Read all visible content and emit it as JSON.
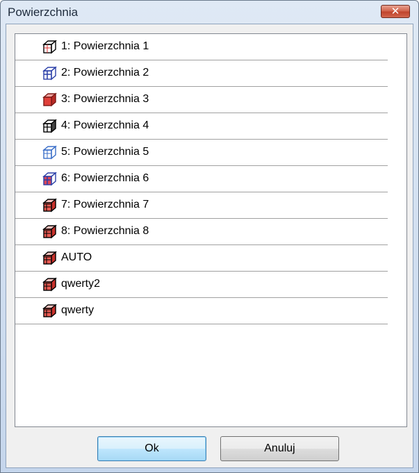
{
  "window": {
    "title": "Powierzchnia",
    "close_glyph": "✕"
  },
  "list": {
    "items": [
      {
        "label": "1: Powierzchnia 1",
        "icon": "wireframe-cube-icon",
        "variant": "wire-red-front"
      },
      {
        "label": "2: Powierzchnia 2",
        "icon": "wireframe-cube-blue-icon",
        "variant": "wire-blue"
      },
      {
        "label": "3: Powierzchnia 3",
        "icon": "solid-red-cube-icon",
        "variant": "solid-red"
      },
      {
        "label": "4: Powierzchnia 4",
        "icon": "hatched-cube-icon",
        "variant": "hatched"
      },
      {
        "label": "5: Powierzchnia 5",
        "icon": "wireframe-cube-icon",
        "variant": "wire-light"
      },
      {
        "label": "6: Powierzchnia 6",
        "icon": "wireframe-cube-blue-icon",
        "variant": "wire-blue-red"
      },
      {
        "label": "7: Powierzchnia 7",
        "icon": "red-cube-icon",
        "variant": "red-shaded"
      },
      {
        "label": "8: Powierzchnia 8",
        "icon": "red-cube-icon",
        "variant": "red-shaded"
      },
      {
        "label": "AUTO",
        "icon": "red-cube-icon",
        "variant": "red-shaded"
      },
      {
        "label": "qwerty2",
        "icon": "red-cube-icon",
        "variant": "red-shaded"
      },
      {
        "label": "qwerty",
        "icon": "red-cube-icon",
        "variant": "red-shaded"
      }
    ]
  },
  "buttons": {
    "ok_label": "Ok",
    "cancel_label": "Anuluj"
  },
  "colors": {
    "accent": "#3c7fb1",
    "close_red": "#c0442c",
    "cube_red": "#e0403a",
    "cube_blue": "#2a3fa8"
  }
}
